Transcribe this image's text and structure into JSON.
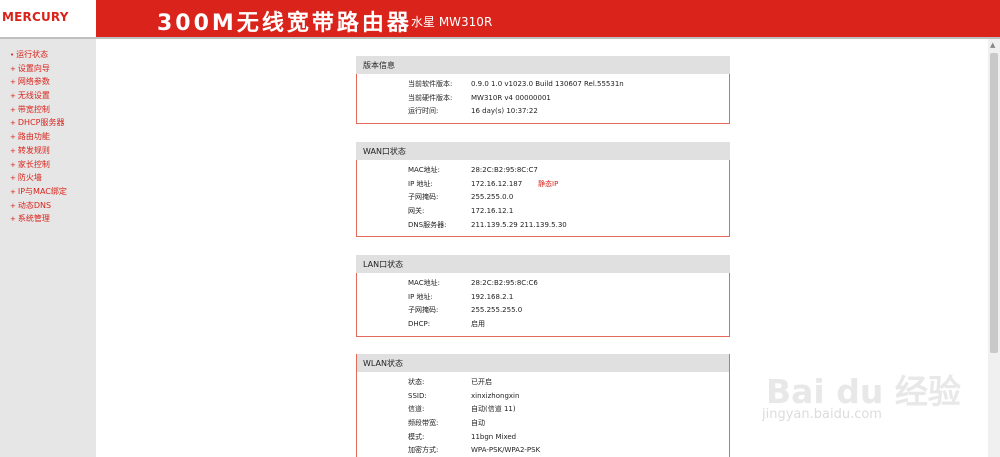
{
  "header": {
    "logo_text": "MERCURY",
    "product_title": "300M无线宽带路由器",
    "brand_model": "水星 MW310R"
  },
  "sidebar": {
    "items": [
      {
        "label": "运行状态"
      },
      {
        "label": "设置向导"
      },
      {
        "label": "网络参数"
      },
      {
        "label": "无线设置"
      },
      {
        "label": "带宽控制"
      },
      {
        "label": "DHCP服务器"
      },
      {
        "label": "路由功能"
      },
      {
        "label": "转发规则"
      },
      {
        "label": "家长控制"
      },
      {
        "label": "防火墙"
      },
      {
        "label": "IP与MAC绑定"
      },
      {
        "label": "动态DNS"
      },
      {
        "label": "系统管理"
      }
    ]
  },
  "panels": {
    "version": {
      "title": "版本信息",
      "rows": [
        {
          "label": "当前软件版本:",
          "value": "0.9.0 1.0 v1023.0 Build 130607 Rel.55531n"
        },
        {
          "label": "当前硬件版本:",
          "value": "MW310R v4 00000001"
        },
        {
          "label": "运行时间:",
          "value": "16 day(s) 10:37:22"
        }
      ]
    },
    "wan": {
      "title": "WAN口状态",
      "rows": [
        {
          "label": "MAC地址:",
          "value": "28:2C:B2:95:8C:C7"
        },
        {
          "label": "IP 地址:",
          "value": "172.16.12.187",
          "extra": "静态IP"
        },
        {
          "label": "子网掩码:",
          "value": "255.255.0.0"
        },
        {
          "label": "网关:",
          "value": "172.16.12.1"
        },
        {
          "label": "DNS服务器:",
          "value": "211.139.5.29 211.139.5.30"
        }
      ]
    },
    "lan": {
      "title": "LAN口状态",
      "rows": [
        {
          "label": "MAC地址:",
          "value": "28:2C:B2:95:8C:C6"
        },
        {
          "label": "IP 地址:",
          "value": "192.168.2.1"
        },
        {
          "label": "子网掩码:",
          "value": "255.255.255.0"
        },
        {
          "label": "DHCP:",
          "value": "启用"
        }
      ]
    },
    "wlan": {
      "title": "WLAN状态",
      "rows": [
        {
          "label": "状态:",
          "value": "已开启"
        },
        {
          "label": "SSID:",
          "value": "xinxizhongxin"
        },
        {
          "label": "信道:",
          "value": "自动(信道 11)"
        },
        {
          "label": "频段带宽:",
          "value": "自动"
        },
        {
          "label": "模式:",
          "value": "11bgn Mixed"
        },
        {
          "label": "加密方式:",
          "value": "WPA-PSK/WPA2-PSK"
        }
      ]
    }
  },
  "watermark": {
    "text": "Bai du 经验",
    "url": "jingyan.baidu.com"
  },
  "colors": {
    "brand_red": "#d9231b",
    "sidebar_bg": "#e6e6e6",
    "panel_header_bg": "#e0e0e0",
    "panel_border": "#e46a5e"
  }
}
